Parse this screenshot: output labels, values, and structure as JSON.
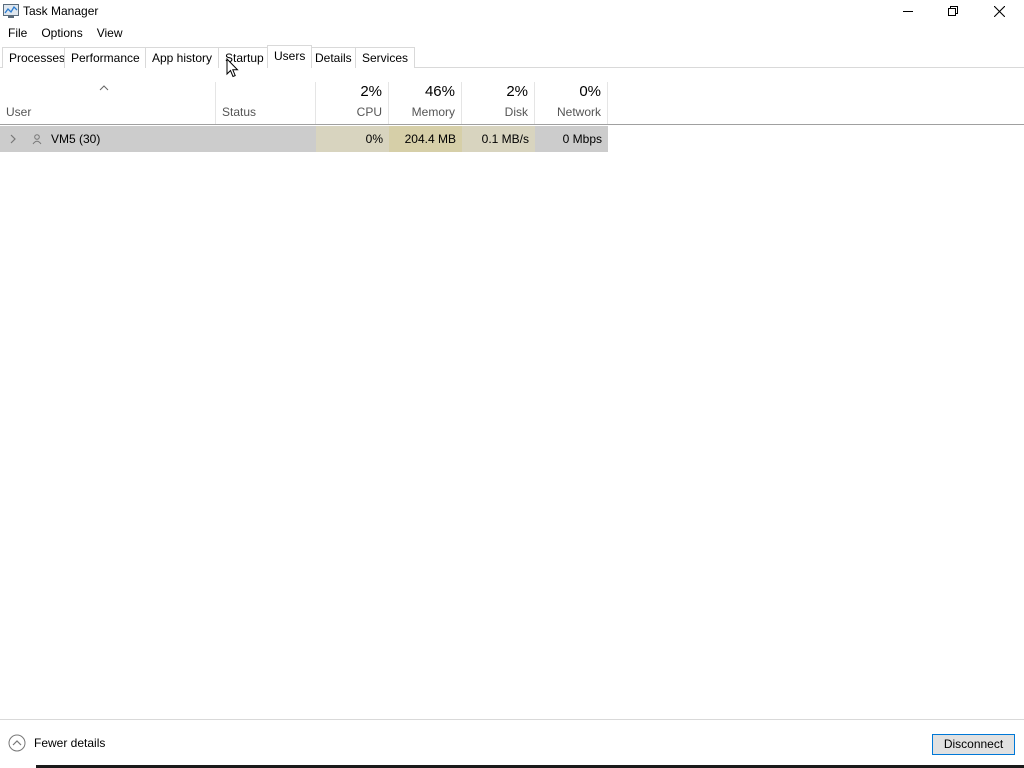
{
  "window": {
    "title": "Task Manager",
    "icon": "task-manager-icon",
    "controls": [
      "minimize-icon",
      "maximize-icon",
      "close-icon"
    ]
  },
  "menu": [
    "File",
    "Options",
    "View"
  ],
  "tabs": [
    {
      "label": "Processes",
      "active": false
    },
    {
      "label": "Performance",
      "active": false
    },
    {
      "label": "App history",
      "active": false
    },
    {
      "label": "Startup",
      "active": false
    },
    {
      "label": "Users",
      "active": true
    },
    {
      "label": "Details",
      "active": false
    },
    {
      "label": "Services",
      "active": false
    }
  ],
  "columns": {
    "user": {
      "label": "User",
      "sort": "ascending"
    },
    "status": {
      "label": "Status"
    },
    "cpu": {
      "percent": "2%",
      "label": "CPU"
    },
    "memory": {
      "percent": "46%",
      "label": "Memory"
    },
    "disk": {
      "percent": "2%",
      "label": "Disk"
    },
    "network": {
      "percent": "0%",
      "label": "Network"
    }
  },
  "rows": [
    {
      "user": "VM5 (30)",
      "status": "",
      "cpu": "0%",
      "memory": "204.4 MB",
      "disk": "0.1 MB/s",
      "network": "0 Mbps"
    }
  ],
  "footer": {
    "fewer_details": "Fewer details",
    "disconnect": "Disconnect"
  },
  "colors": {
    "heat_light": "#fff4c4",
    "heat_medium": "#f9ecb0",
    "row_selected": "#cccccc",
    "accent": "#0078d7"
  }
}
